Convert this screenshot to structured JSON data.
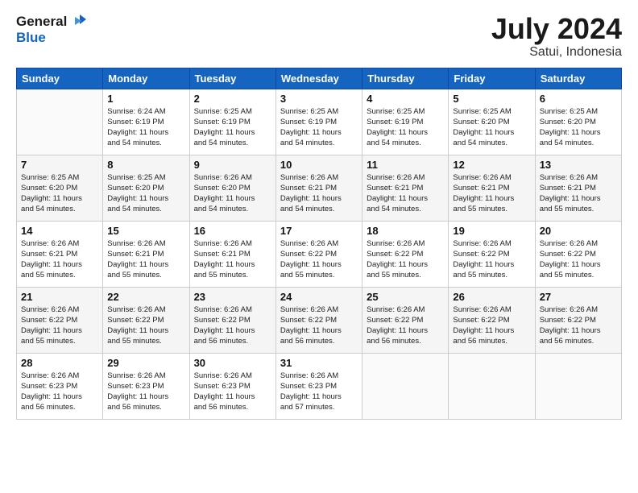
{
  "header": {
    "logo_line1": "General",
    "logo_line2": "Blue",
    "month_year": "July 2024",
    "location": "Satui, Indonesia"
  },
  "days_of_week": [
    "Sunday",
    "Monday",
    "Tuesday",
    "Wednesday",
    "Thursday",
    "Friday",
    "Saturday"
  ],
  "weeks": [
    [
      {
        "day": "",
        "info": ""
      },
      {
        "day": "1",
        "info": "Sunrise: 6:24 AM\nSunset: 6:19 PM\nDaylight: 11 hours\nand 54 minutes."
      },
      {
        "day": "2",
        "info": "Sunrise: 6:25 AM\nSunset: 6:19 PM\nDaylight: 11 hours\nand 54 minutes."
      },
      {
        "day": "3",
        "info": "Sunrise: 6:25 AM\nSunset: 6:19 PM\nDaylight: 11 hours\nand 54 minutes."
      },
      {
        "day": "4",
        "info": "Sunrise: 6:25 AM\nSunset: 6:19 PM\nDaylight: 11 hours\nand 54 minutes."
      },
      {
        "day": "5",
        "info": "Sunrise: 6:25 AM\nSunset: 6:20 PM\nDaylight: 11 hours\nand 54 minutes."
      },
      {
        "day": "6",
        "info": "Sunrise: 6:25 AM\nSunset: 6:20 PM\nDaylight: 11 hours\nand 54 minutes."
      }
    ],
    [
      {
        "day": "7",
        "info": "Sunrise: 6:25 AM\nSunset: 6:20 PM\nDaylight: 11 hours\nand 54 minutes."
      },
      {
        "day": "8",
        "info": "Sunrise: 6:25 AM\nSunset: 6:20 PM\nDaylight: 11 hours\nand 54 minutes."
      },
      {
        "day": "9",
        "info": "Sunrise: 6:26 AM\nSunset: 6:20 PM\nDaylight: 11 hours\nand 54 minutes."
      },
      {
        "day": "10",
        "info": "Sunrise: 6:26 AM\nSunset: 6:21 PM\nDaylight: 11 hours\nand 54 minutes."
      },
      {
        "day": "11",
        "info": "Sunrise: 6:26 AM\nSunset: 6:21 PM\nDaylight: 11 hours\nand 54 minutes."
      },
      {
        "day": "12",
        "info": "Sunrise: 6:26 AM\nSunset: 6:21 PM\nDaylight: 11 hours\nand 55 minutes."
      },
      {
        "day": "13",
        "info": "Sunrise: 6:26 AM\nSunset: 6:21 PM\nDaylight: 11 hours\nand 55 minutes."
      }
    ],
    [
      {
        "day": "14",
        "info": "Sunrise: 6:26 AM\nSunset: 6:21 PM\nDaylight: 11 hours\nand 55 minutes."
      },
      {
        "day": "15",
        "info": "Sunrise: 6:26 AM\nSunset: 6:21 PM\nDaylight: 11 hours\nand 55 minutes."
      },
      {
        "day": "16",
        "info": "Sunrise: 6:26 AM\nSunset: 6:21 PM\nDaylight: 11 hours\nand 55 minutes."
      },
      {
        "day": "17",
        "info": "Sunrise: 6:26 AM\nSunset: 6:22 PM\nDaylight: 11 hours\nand 55 minutes."
      },
      {
        "day": "18",
        "info": "Sunrise: 6:26 AM\nSunset: 6:22 PM\nDaylight: 11 hours\nand 55 minutes."
      },
      {
        "day": "19",
        "info": "Sunrise: 6:26 AM\nSunset: 6:22 PM\nDaylight: 11 hours\nand 55 minutes."
      },
      {
        "day": "20",
        "info": "Sunrise: 6:26 AM\nSunset: 6:22 PM\nDaylight: 11 hours\nand 55 minutes."
      }
    ],
    [
      {
        "day": "21",
        "info": "Sunrise: 6:26 AM\nSunset: 6:22 PM\nDaylight: 11 hours\nand 55 minutes."
      },
      {
        "day": "22",
        "info": "Sunrise: 6:26 AM\nSunset: 6:22 PM\nDaylight: 11 hours\nand 55 minutes."
      },
      {
        "day": "23",
        "info": "Sunrise: 6:26 AM\nSunset: 6:22 PM\nDaylight: 11 hours\nand 56 minutes."
      },
      {
        "day": "24",
        "info": "Sunrise: 6:26 AM\nSunset: 6:22 PM\nDaylight: 11 hours\nand 56 minutes."
      },
      {
        "day": "25",
        "info": "Sunrise: 6:26 AM\nSunset: 6:22 PM\nDaylight: 11 hours\nand 56 minutes."
      },
      {
        "day": "26",
        "info": "Sunrise: 6:26 AM\nSunset: 6:22 PM\nDaylight: 11 hours\nand 56 minutes."
      },
      {
        "day": "27",
        "info": "Sunrise: 6:26 AM\nSunset: 6:22 PM\nDaylight: 11 hours\nand 56 minutes."
      }
    ],
    [
      {
        "day": "28",
        "info": "Sunrise: 6:26 AM\nSunset: 6:23 PM\nDaylight: 11 hours\nand 56 minutes."
      },
      {
        "day": "29",
        "info": "Sunrise: 6:26 AM\nSunset: 6:23 PM\nDaylight: 11 hours\nand 56 minutes."
      },
      {
        "day": "30",
        "info": "Sunrise: 6:26 AM\nSunset: 6:23 PM\nDaylight: 11 hours\nand 56 minutes."
      },
      {
        "day": "31",
        "info": "Sunrise: 6:26 AM\nSunset: 6:23 PM\nDaylight: 11 hours\nand 57 minutes."
      },
      {
        "day": "",
        "info": ""
      },
      {
        "day": "",
        "info": ""
      },
      {
        "day": "",
        "info": ""
      }
    ]
  ]
}
